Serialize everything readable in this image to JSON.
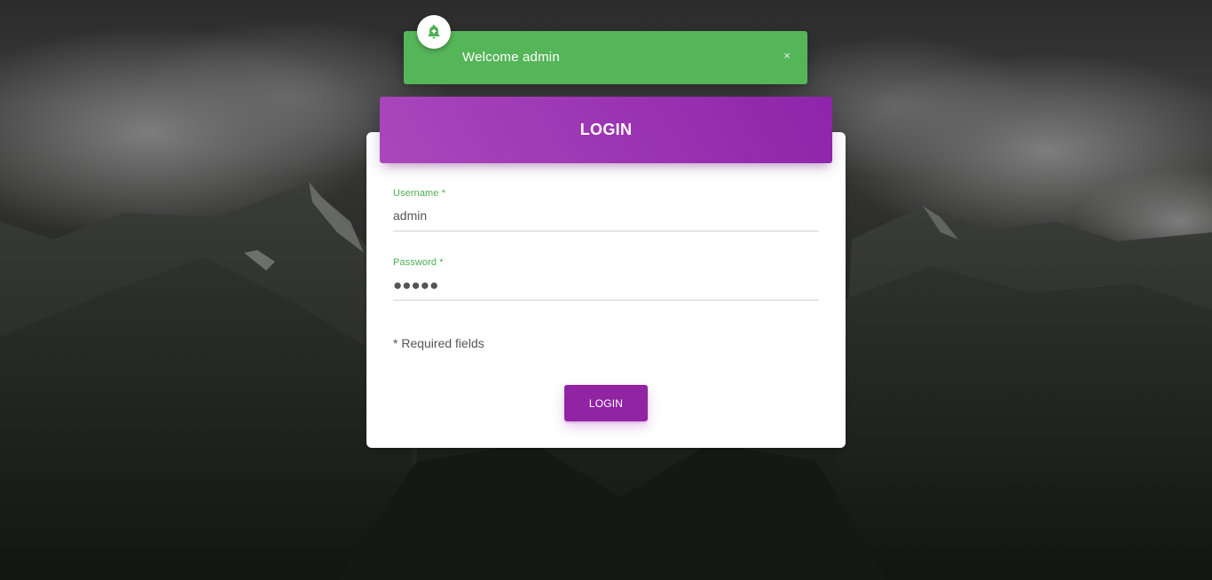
{
  "notification": {
    "icon": "bell-icon",
    "message": "Welcome admin",
    "close_label": "×",
    "color": "#55b559"
  },
  "login_card": {
    "title": "LOGIN",
    "header_color": "#9c27b0",
    "username": {
      "label": "Username *",
      "value": "admin"
    },
    "password": {
      "label": "Password *",
      "masked_value": "●●●●●"
    },
    "required_note": "* Required fields",
    "submit_label": "LOGIN",
    "accent_color": "#4caf50"
  }
}
